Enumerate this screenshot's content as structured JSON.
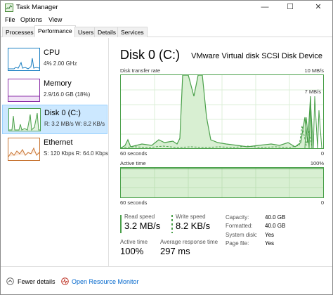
{
  "window": {
    "title": "Task Manager",
    "controls": {
      "minimize": "—",
      "maximize": "☐",
      "close": "✕"
    }
  },
  "menu": [
    "File",
    "Options",
    "View"
  ],
  "tabs": [
    "Processes",
    "Performance",
    "Users",
    "Details",
    "Services"
  ],
  "active_tab": "Performance",
  "resources": [
    {
      "name": "CPU",
      "sub": "4% 2.00 GHz",
      "color": "#1b7fc2",
      "selected": false
    },
    {
      "name": "Memory",
      "sub": "2.9/16.0 GB (18%)",
      "color": "#8b2fa8",
      "selected": false
    },
    {
      "name": "Disk 0 (C:)",
      "sub": "R: 3.2 MB/s  W: 8.2 KB/s",
      "color": "#4aa04a",
      "selected": true
    },
    {
      "name": "Ethernet",
      "sub": "S: 120 Kbps  R: 64.0 Kbps",
      "color": "#c87533",
      "selected": false
    }
  ],
  "detail": {
    "title": "Disk 0 (C:)",
    "model": "VMware Virtual disk SCSI Disk Device",
    "chart1": {
      "label": "Disk transfer rate",
      "max": "10 MB/s",
      "secondary_max": "7 MB/s",
      "time": "60 seconds",
      "min": "0"
    },
    "chart2": {
      "label": "Active time",
      "max": "100%",
      "time": "60 seconds",
      "min": "0"
    },
    "stats": {
      "read_label": "Read speed",
      "read_value": "3.2 MB/s",
      "write_label": "Write speed",
      "write_value": "8.2 KB/s",
      "active_label": "Active time",
      "active_value": "100%",
      "response_label": "Average response time",
      "response_value": "297 ms"
    },
    "info": [
      {
        "k": "Capacity:",
        "v": "40.0 GB"
      },
      {
        "k": "Formatted:",
        "v": "40.0 GB"
      },
      {
        "k": "System disk:",
        "v": "Yes"
      },
      {
        "k": "Page file:",
        "v": "Yes"
      }
    ]
  },
  "footer": {
    "fewer_details": "Fewer details",
    "open_monitor": "Open Resource Monitor"
  },
  "colors": {
    "accent_green": "#4aa04a",
    "link": "#0066cc",
    "selected_bg": "#cce8ff"
  }
}
